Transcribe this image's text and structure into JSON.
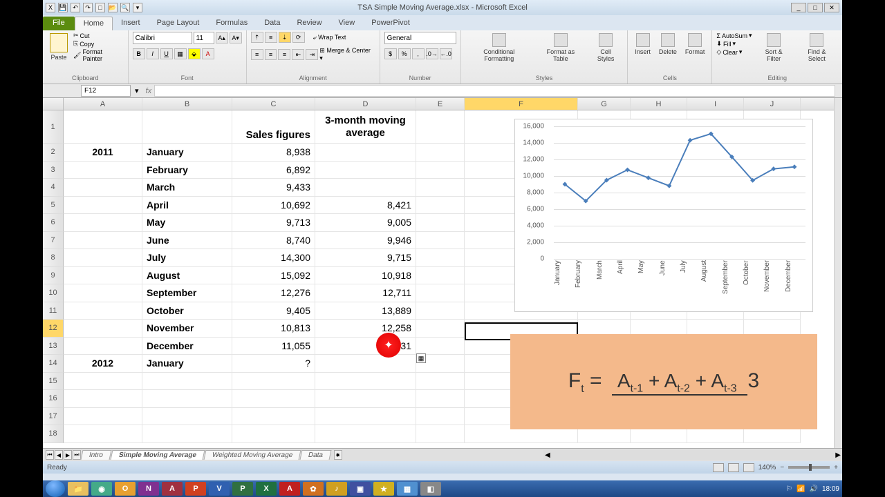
{
  "app": {
    "title": "TSA Simple Moving Average.xlsx - Microsoft Excel",
    "suite": "Microsoft Excel"
  },
  "ribbon": {
    "file": "File",
    "tabs": [
      "Home",
      "Insert",
      "Page Layout",
      "Formulas",
      "Data",
      "Review",
      "View",
      "PowerPivot"
    ],
    "active_tab": "Home",
    "clipboard": {
      "name": "Clipboard",
      "paste": "Paste",
      "cut": "Cut",
      "copy": "Copy",
      "fmt": "Format Painter"
    },
    "font": {
      "name": "Font",
      "family": "Calibri",
      "size": "11"
    },
    "alignment": {
      "name": "Alignment",
      "wrap": "Wrap Text",
      "merge": "Merge & Center"
    },
    "number": {
      "name": "Number",
      "format": "General"
    },
    "styles": {
      "name": "Styles",
      "cf": "Conditional\nFormatting",
      "fat": "Format\nas Table",
      "cs": "Cell\nStyles"
    },
    "cells": {
      "name": "Cells",
      "insert": "Insert",
      "delete": "Delete",
      "format": "Format"
    },
    "editing": {
      "name": "Editing",
      "autosum": "AutoSum",
      "fill": "Fill",
      "clear": "Clear",
      "sort": "Sort &\nFilter",
      "find": "Find &\nSelect"
    }
  },
  "formula_bar": {
    "name_box": "F12",
    "fx": "fx",
    "value": ""
  },
  "grid": {
    "columns": [
      "A",
      "B",
      "C",
      "D",
      "E",
      "F",
      "G",
      "H",
      "I",
      "J"
    ],
    "selected_col": "F",
    "selected_row": 12,
    "headers": {
      "c": "Sales figures",
      "d": "3-month moving\naverage"
    },
    "rows": [
      {
        "n": 2,
        "a": "2011",
        "b": "January",
        "c": "8,938",
        "d": ""
      },
      {
        "n": 3,
        "a": "",
        "b": "February",
        "c": "6,892",
        "d": ""
      },
      {
        "n": 4,
        "a": "",
        "b": "March",
        "c": "9,433",
        "d": ""
      },
      {
        "n": 5,
        "a": "",
        "b": "April",
        "c": "10,692",
        "d": "8,421"
      },
      {
        "n": 6,
        "a": "",
        "b": "May",
        "c": "9,713",
        "d": "9,005"
      },
      {
        "n": 7,
        "a": "",
        "b": "June",
        "c": "8,740",
        "d": "9,946"
      },
      {
        "n": 8,
        "a": "",
        "b": "July",
        "c": "14,300",
        "d": "9,715"
      },
      {
        "n": 9,
        "a": "",
        "b": "August",
        "c": "15,092",
        "d": "10,918"
      },
      {
        "n": 10,
        "a": "",
        "b": "September",
        "c": "12,276",
        "d": "12,711"
      },
      {
        "n": 11,
        "a": "",
        "b": "October",
        "c": "9,405",
        "d": "13,889"
      },
      {
        "n": 12,
        "a": "",
        "b": "November",
        "c": "10,813",
        "d": "12,258"
      },
      {
        "n": 13,
        "a": "",
        "b": "December",
        "c": "11,055",
        "d": "10,831"
      },
      {
        "n": 14,
        "a": "2012",
        "b": "January",
        "c": "?",
        "d": ""
      },
      {
        "n": 15,
        "a": "",
        "b": "",
        "c": "",
        "d": ""
      },
      {
        "n": 16,
        "a": "",
        "b": "",
        "c": "",
        "d": ""
      },
      {
        "n": 17,
        "a": "",
        "b": "",
        "c": "",
        "d": ""
      },
      {
        "n": 18,
        "a": "",
        "b": "",
        "c": "",
        "d": ""
      }
    ]
  },
  "chart_data": {
    "type": "line",
    "categories": [
      "January",
      "February",
      "March",
      "April",
      "May",
      "June",
      "July",
      "August",
      "September",
      "October",
      "November",
      "December"
    ],
    "values": [
      8938,
      6892,
      9433,
      10692,
      9713,
      8740,
      14300,
      15092,
      12276,
      9405,
      10813,
      11055
    ],
    "ylim": [
      0,
      16000
    ],
    "yticks": [
      0,
      2000,
      4000,
      6000,
      8000,
      10000,
      12000,
      14000,
      16000
    ],
    "ytick_labels": [
      "0",
      "2,000",
      "4,000",
      "6,000",
      "8,000",
      "10,000",
      "12,000",
      "14,000",
      "16,000"
    ]
  },
  "formula_overlay": {
    "lhs": "F",
    "lhs_sub": "t",
    "eq": " = ",
    "num": "A",
    "sub1": "t-1",
    "plus": " + ",
    "sub2": "t-2",
    "sub3": "t-3",
    "den": "3"
  },
  "sheets": {
    "tabs": [
      "Intro",
      "Simple Moving Average",
      "Weighted Moving Average",
      "Data"
    ],
    "active": "Simple Moving Average"
  },
  "status": {
    "ready": "Ready",
    "zoom": "140%"
  },
  "taskbar": {
    "time": "18:09"
  }
}
